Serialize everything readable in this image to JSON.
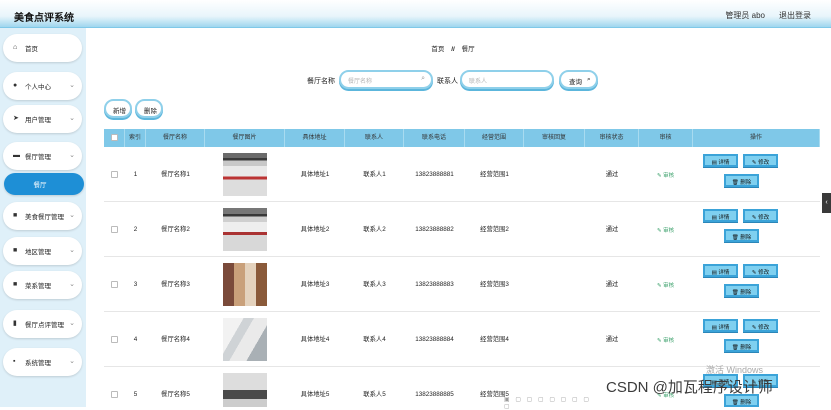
{
  "app": {
    "title": "美食点评系统"
  },
  "header": {
    "user": "管理员 abo",
    "logout": "退出登录"
  },
  "sidebar": {
    "items": [
      {
        "label": "首页",
        "icon": "home-icon"
      },
      {
        "label": "个人中心",
        "icon": "user-icon"
      },
      {
        "label": "用户管理",
        "icon": "send-icon"
      },
      {
        "label": "餐厅管理",
        "icon": "card-icon"
      },
      {
        "label": "餐厅",
        "icon": ""
      },
      {
        "label": "美食餐厅管理",
        "icon": "grid-icon"
      },
      {
        "label": "地区管理",
        "icon": "grid-icon"
      },
      {
        "label": "菜系管理",
        "icon": "grid-icon"
      },
      {
        "label": "餐厅点评管理",
        "icon": "chart-icon"
      },
      {
        "label": "系统管理",
        "icon": "cart-icon"
      }
    ]
  },
  "breadcrumb": {
    "home": "首页",
    "sep": "//",
    "current": "餐厅"
  },
  "search": {
    "name_label": "餐厅名称",
    "name_placeholder": "餐厅名称",
    "contact_label": "联系人",
    "contact_placeholder": "联系人",
    "query_label": "查询"
  },
  "actions": {
    "add": "新增",
    "delete": "删除"
  },
  "table": {
    "headers": [
      "",
      "索引",
      "餐厅名称",
      "餐厅图片",
      "具体地址",
      "联系人",
      "联系电话",
      "经营范围",
      "审核回复",
      "审核状态",
      "审核",
      "操作"
    ],
    "audit_link": "审核",
    "buttons": {
      "detail": "详情",
      "edit": "修改",
      "delete": "删除"
    },
    "rows": [
      {
        "index": "1",
        "name": "餐厅名称1",
        "address": "具体地址1",
        "contact": "联系人1",
        "phone": "13823888881",
        "scope": "经营范围1",
        "reply": "",
        "status": "通过"
      },
      {
        "index": "2",
        "name": "餐厅名称2",
        "address": "具体地址2",
        "contact": "联系人2",
        "phone": "13823888882",
        "scope": "经营范围2",
        "reply": "",
        "status": "通过"
      },
      {
        "index": "3",
        "name": "餐厅名称3",
        "address": "具体地址3",
        "contact": "联系人3",
        "phone": "13823888883",
        "scope": "经营范围3",
        "reply": "",
        "status": "通过"
      },
      {
        "index": "4",
        "name": "餐厅名称4",
        "address": "具体地址4",
        "contact": "联系人4",
        "phone": "13823888884",
        "scope": "经营范围4",
        "reply": "",
        "status": "通过"
      },
      {
        "index": "5",
        "name": "餐厅名称5",
        "address": "具体地址5",
        "contact": "联系人5",
        "phone": "13823888885",
        "scope": "经营范围5",
        "reply": "",
        "status": ""
      }
    ]
  },
  "overlay": {
    "activate": "激活 Windows",
    "csdn": "CSDN @加瓦程序设计师"
  },
  "colors": {
    "accent": "#1e8fd6",
    "header_row": "#7fc8e8",
    "button": "#7fd0f0",
    "sidebar_bg": "#dff0f9"
  }
}
